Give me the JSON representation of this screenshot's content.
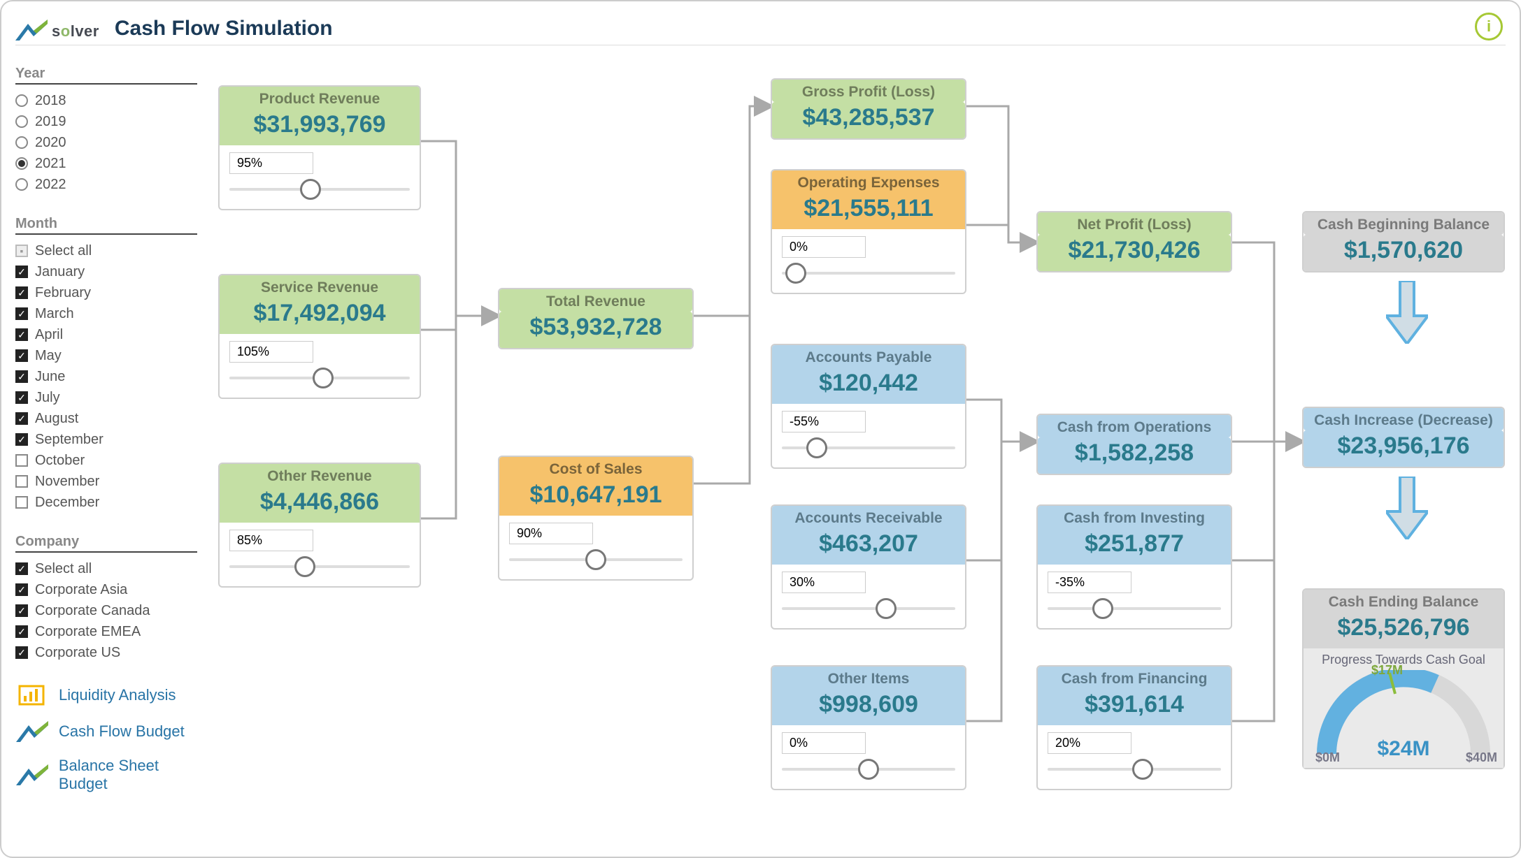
{
  "header": {
    "title": "Cash Flow Simulation"
  },
  "filters": {
    "year": {
      "label": "Year",
      "options": [
        "2018",
        "2019",
        "2020",
        "2021",
        "2022"
      ],
      "selected": "2021"
    },
    "month": {
      "label": "Month",
      "select_all_label": "Select all",
      "items": [
        {
          "label": "January",
          "sel": true
        },
        {
          "label": "February",
          "sel": true
        },
        {
          "label": "March",
          "sel": true
        },
        {
          "label": "April",
          "sel": true
        },
        {
          "label": "May",
          "sel": true
        },
        {
          "label": "June",
          "sel": true
        },
        {
          "label": "July",
          "sel": true
        },
        {
          "label": "August",
          "sel": true
        },
        {
          "label": "September",
          "sel": true
        },
        {
          "label": "October",
          "sel": false
        },
        {
          "label": "November",
          "sel": false
        },
        {
          "label": "December",
          "sel": false
        }
      ]
    },
    "company": {
      "label": "Company",
      "select_all_label": "Select all",
      "items": [
        {
          "label": "Corporate Asia",
          "sel": true
        },
        {
          "label": "Corporate Canada",
          "sel": true
        },
        {
          "label": "Corporate EMEA",
          "sel": true
        },
        {
          "label": "Corporate US",
          "sel": true
        }
      ]
    }
  },
  "links": {
    "liquidity": "Liquidity Analysis",
    "cashflow_budget": "Cash Flow Budget",
    "balance_sheet_budget": "Balance Sheet Budget"
  },
  "nodes": {
    "product_rev": {
      "label": "Product Revenue",
      "value": "$31,993,769",
      "pct": "95%",
      "thumb": 0.45
    },
    "service_rev": {
      "label": "Service Revenue",
      "value": "$17,492,094",
      "pct": "105%",
      "thumb": 0.52
    },
    "other_rev": {
      "label": "Other Revenue",
      "value": "$4,446,866",
      "pct": "85%",
      "thumb": 0.42
    },
    "total_rev": {
      "label": "Total Revenue",
      "value": "$53,932,728"
    },
    "cost_sales": {
      "label": "Cost of Sales",
      "value": "$10,647,191",
      "pct": "90%",
      "thumb": 0.5
    },
    "gross_profit": {
      "label": "Gross Profit (Loss)",
      "value": "$43,285,537"
    },
    "opex": {
      "label": "Operating Expenses",
      "value": "$21,555,111",
      "pct": "0%",
      "thumb": 0.08
    },
    "net_profit": {
      "label": "Net Profit (Loss)",
      "value": "$21,730,426"
    },
    "ap": {
      "label": "Accounts Payable",
      "value": "$120,442",
      "pct": "-55%",
      "thumb": 0.2
    },
    "ar": {
      "label": "Accounts Receivable",
      "value": "$463,207",
      "pct": "30%",
      "thumb": 0.6
    },
    "other_items": {
      "label": "Other Items",
      "value": "$998,609",
      "pct": "0%",
      "thumb": 0.5
    },
    "cash_ops": {
      "label": "Cash from Operations",
      "value": "$1,582,258"
    },
    "cash_invest": {
      "label": "Cash from Investing",
      "value": "$251,877",
      "pct": "-35%",
      "thumb": 0.32
    },
    "cash_fin": {
      "label": "Cash from Financing",
      "value": "$391,614",
      "pct": "20%",
      "thumb": 0.55
    },
    "cash_begin": {
      "label": "Cash Beginning Balance",
      "value": "$1,570,620"
    },
    "cash_inc": {
      "label": "Cash Increase (Decrease)",
      "value": "$23,956,176"
    },
    "cash_end": {
      "label": "Cash Ending Balance",
      "value": "$25,526,796"
    }
  },
  "gauge": {
    "title": "Progress Towards Cash Goal",
    "min_label": "$0M",
    "max_label": "$40M",
    "target_label": "$17M",
    "center_label": "$24M"
  },
  "chart_data": {
    "type": "area",
    "title": "Progress Towards Cash Goal",
    "min": 0,
    "max": 40,
    "value": 24,
    "target": 17,
    "unit": "$M",
    "filters_applied": {
      "year": 2021,
      "months": [
        "January",
        "February",
        "March",
        "April",
        "May",
        "June",
        "July",
        "August",
        "September"
      ],
      "companies": [
        "Corporate Asia",
        "Corporate Canada",
        "Corporate EMEA",
        "Corporate US"
      ]
    },
    "flow": [
      {
        "name": "Product Revenue",
        "value": 31993769,
        "slider_pct": 95
      },
      {
        "name": "Service Revenue",
        "value": 17492094,
        "slider_pct": 105
      },
      {
        "name": "Other Revenue",
        "value": 4446866,
        "slider_pct": 85
      },
      {
        "name": "Total Revenue",
        "value": 53932728
      },
      {
        "name": "Cost of Sales",
        "value": 10647191,
        "slider_pct": 90
      },
      {
        "name": "Gross Profit (Loss)",
        "value": 43285537
      },
      {
        "name": "Operating Expenses",
        "value": 21555111,
        "slider_pct": 0
      },
      {
        "name": "Net Profit (Loss)",
        "value": 21730426
      },
      {
        "name": "Accounts Payable",
        "value": 120442,
        "slider_pct": -55
      },
      {
        "name": "Accounts Receivable",
        "value": 463207,
        "slider_pct": 30
      },
      {
        "name": "Other Items",
        "value": 998609,
        "slider_pct": 0
      },
      {
        "name": "Cash from Operations",
        "value": 1582258
      },
      {
        "name": "Cash from Investing",
        "value": 251877,
        "slider_pct": -35
      },
      {
        "name": "Cash from Financing",
        "value": 391614,
        "slider_pct": 20
      },
      {
        "name": "Cash Beginning Balance",
        "value": 1570620
      },
      {
        "name": "Cash Increase (Decrease)",
        "value": 23956176
      },
      {
        "name": "Cash Ending Balance",
        "value": 25526796
      }
    ]
  }
}
